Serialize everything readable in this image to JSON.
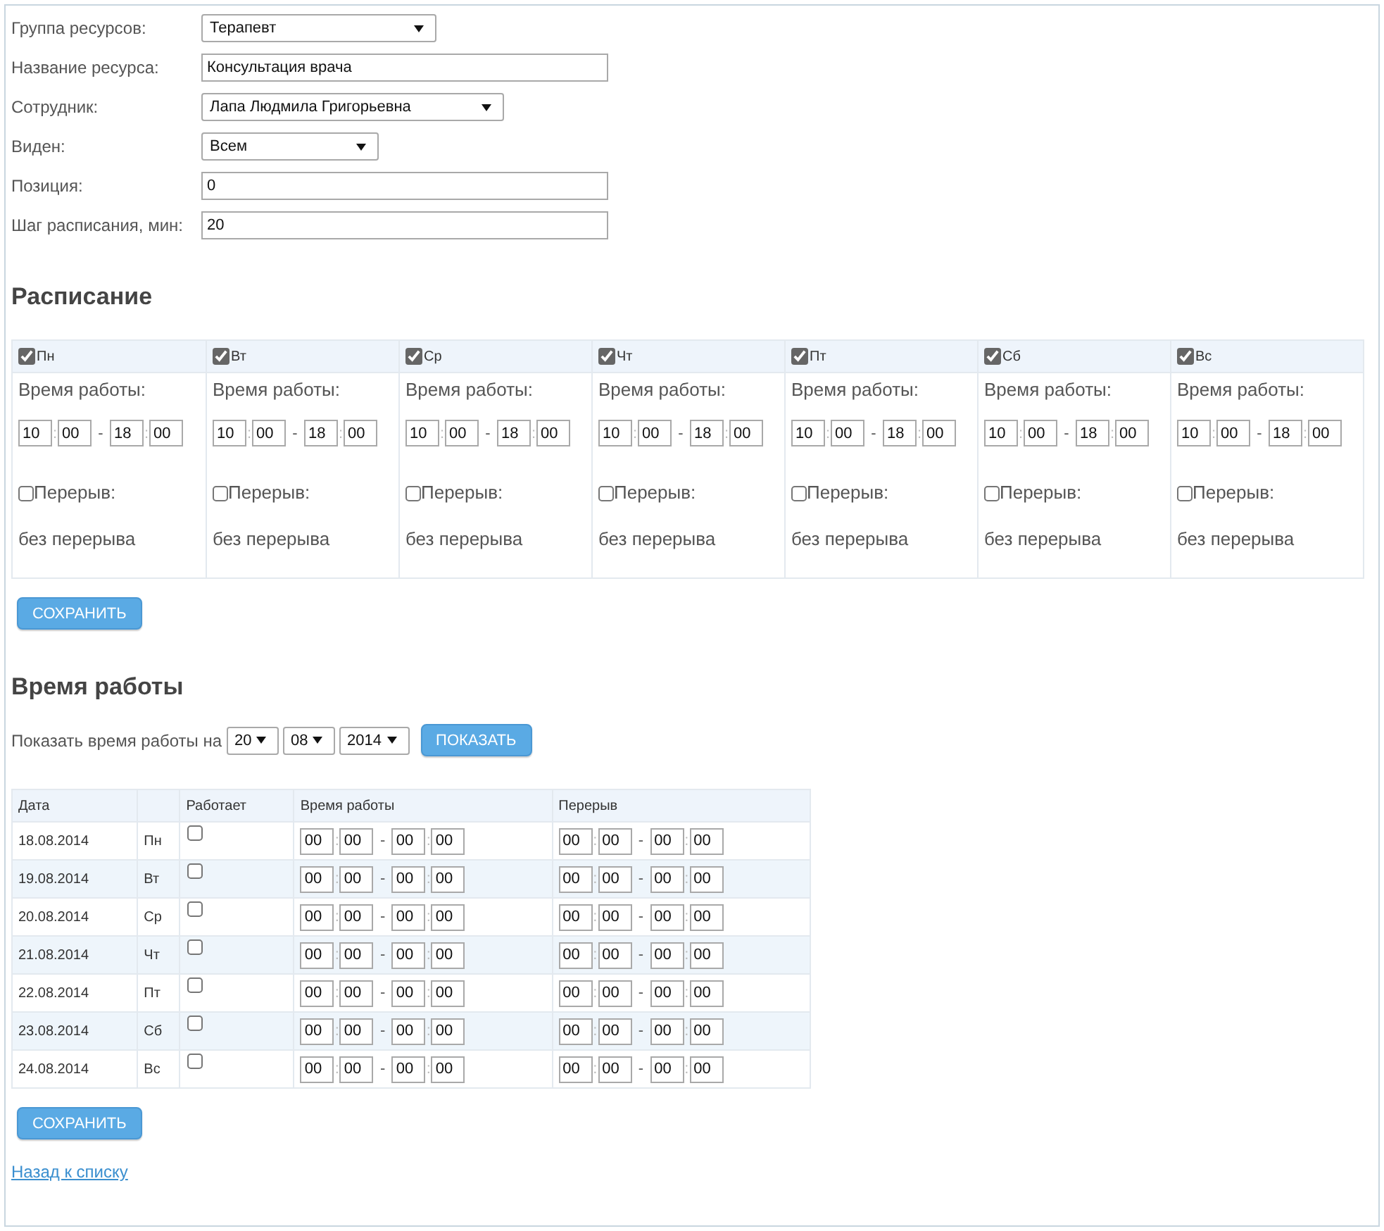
{
  "form": {
    "fields": [
      {
        "label": "Группа ресурсов:",
        "kind": "select",
        "value": "Терапевт"
      },
      {
        "label": "Название ресурса:",
        "kind": "text",
        "value": "Консультация врача"
      },
      {
        "label": "Сотрудник:",
        "kind": "select",
        "value": "Лапа Людмила Григорьевна"
      },
      {
        "label": "Виден:",
        "kind": "select",
        "value": "Всем"
      },
      {
        "label": "Позиция:",
        "kind": "text",
        "value": "0"
      },
      {
        "label": "Шаг расписания, мин:",
        "kind": "text",
        "value": "20"
      }
    ]
  },
  "schedule": {
    "title": "Расписание",
    "days": [
      {
        "day": "Пн",
        "checked": true,
        "work_label": "Время работы:",
        "hours": [
          "10",
          ":",
          "00",
          "-",
          "18",
          ":",
          "00"
        ],
        "break_label": "Перерыв:",
        "break_checked": false,
        "break_text": "без перерыва"
      },
      {
        "day": "Вт",
        "checked": true,
        "work_label": "Время работы:",
        "hours": [
          "10",
          ":",
          "00",
          "-",
          "18",
          ":",
          "00"
        ],
        "break_label": "Перерыв:",
        "break_checked": false,
        "break_text": "без перерыва"
      },
      {
        "day": "Ср",
        "checked": true,
        "work_label": "Время работы:",
        "hours": [
          "10",
          ":",
          "00",
          "-",
          "18",
          ":",
          "00"
        ],
        "break_label": "Перерыв:",
        "break_checked": false,
        "break_text": "без перерыва"
      },
      {
        "day": "Чт",
        "checked": true,
        "work_label": "Время работы:",
        "hours": [
          "10",
          ":",
          "00",
          "-",
          "18",
          ":",
          "00"
        ],
        "break_label": "Перерыв:",
        "break_checked": false,
        "break_text": "без перерыва"
      },
      {
        "day": "Пт",
        "checked": true,
        "work_label": "Время работы:",
        "hours": [
          "10",
          ":",
          "00",
          "-",
          "18",
          ":",
          "00"
        ],
        "break_label": "Перерыв:",
        "break_checked": false,
        "break_text": "без перерыва"
      },
      {
        "day": "Сб",
        "checked": true,
        "work_label": "Время работы:",
        "hours": [
          "10",
          ":",
          "00",
          "-",
          "18",
          ":",
          "00"
        ],
        "break_label": "Перерыв:",
        "break_checked": false,
        "break_text": "без перерыва"
      },
      {
        "day": "Вс",
        "checked": true,
        "work_label": "Время работы:",
        "hours": [
          "10",
          ":",
          "00",
          "-",
          "18",
          ":",
          "00"
        ],
        "break_label": "Перерыв:",
        "break_checked": false,
        "break_text": "без перерыва"
      }
    ],
    "save_button": "СОХРАНИТЬ"
  },
  "working_time": {
    "title": "Время работы",
    "show_label": "Показать время работы на",
    "day": "20",
    "month": "08",
    "year": "2014",
    "show_button": "ПОКАЗАТЬ",
    "columns": {
      "date": "Дата",
      "works": "Работает",
      "hours": "Время работы",
      "break": "Перерыв"
    },
    "rows": [
      {
        "date": "18.08.2014",
        "day": "Пн",
        "works": false,
        "hours": [
          "00",
          ":",
          "00",
          "-",
          "00",
          ":",
          "00"
        ],
        "break": [
          "00",
          ":",
          "00",
          "-",
          "00",
          ":",
          "00"
        ]
      },
      {
        "date": "19.08.2014",
        "day": "Вт",
        "works": false,
        "hours": [
          "00",
          ":",
          "00",
          "-",
          "00",
          ":",
          "00"
        ],
        "break": [
          "00",
          ":",
          "00",
          "-",
          "00",
          ":",
          "00"
        ]
      },
      {
        "date": "20.08.2014",
        "day": "Ср",
        "works": false,
        "hours": [
          "00",
          ":",
          "00",
          "-",
          "00",
          ":",
          "00"
        ],
        "break": [
          "00",
          ":",
          "00",
          "-",
          "00",
          ":",
          "00"
        ]
      },
      {
        "date": "21.08.2014",
        "day": "Чт",
        "works": false,
        "hours": [
          "00",
          ":",
          "00",
          "-",
          "00",
          ":",
          "00"
        ],
        "break": [
          "00",
          ":",
          "00",
          "-",
          "00",
          ":",
          "00"
        ]
      },
      {
        "date": "22.08.2014",
        "day": "Пт",
        "works": false,
        "hours": [
          "00",
          ":",
          "00",
          "-",
          "00",
          ":",
          "00"
        ],
        "break": [
          "00",
          ":",
          "00",
          "-",
          "00",
          ":",
          "00"
        ]
      },
      {
        "date": "23.08.2014",
        "day": "Сб",
        "works": false,
        "hours": [
          "00",
          ":",
          "00",
          "-",
          "00",
          ":",
          "00"
        ],
        "break": [
          "00",
          ":",
          "00",
          "-",
          "00",
          ":",
          "00"
        ]
      },
      {
        "date": "24.08.2014",
        "day": "Вс",
        "works": false,
        "hours": [
          "00",
          ":",
          "00",
          "-",
          "00",
          ":",
          "00"
        ],
        "break": [
          "00",
          ":",
          "00",
          "-",
          "00",
          ":",
          "00"
        ]
      }
    ],
    "save_button": "СОХРАНИТЬ"
  },
  "back_link": "Назад к списку"
}
